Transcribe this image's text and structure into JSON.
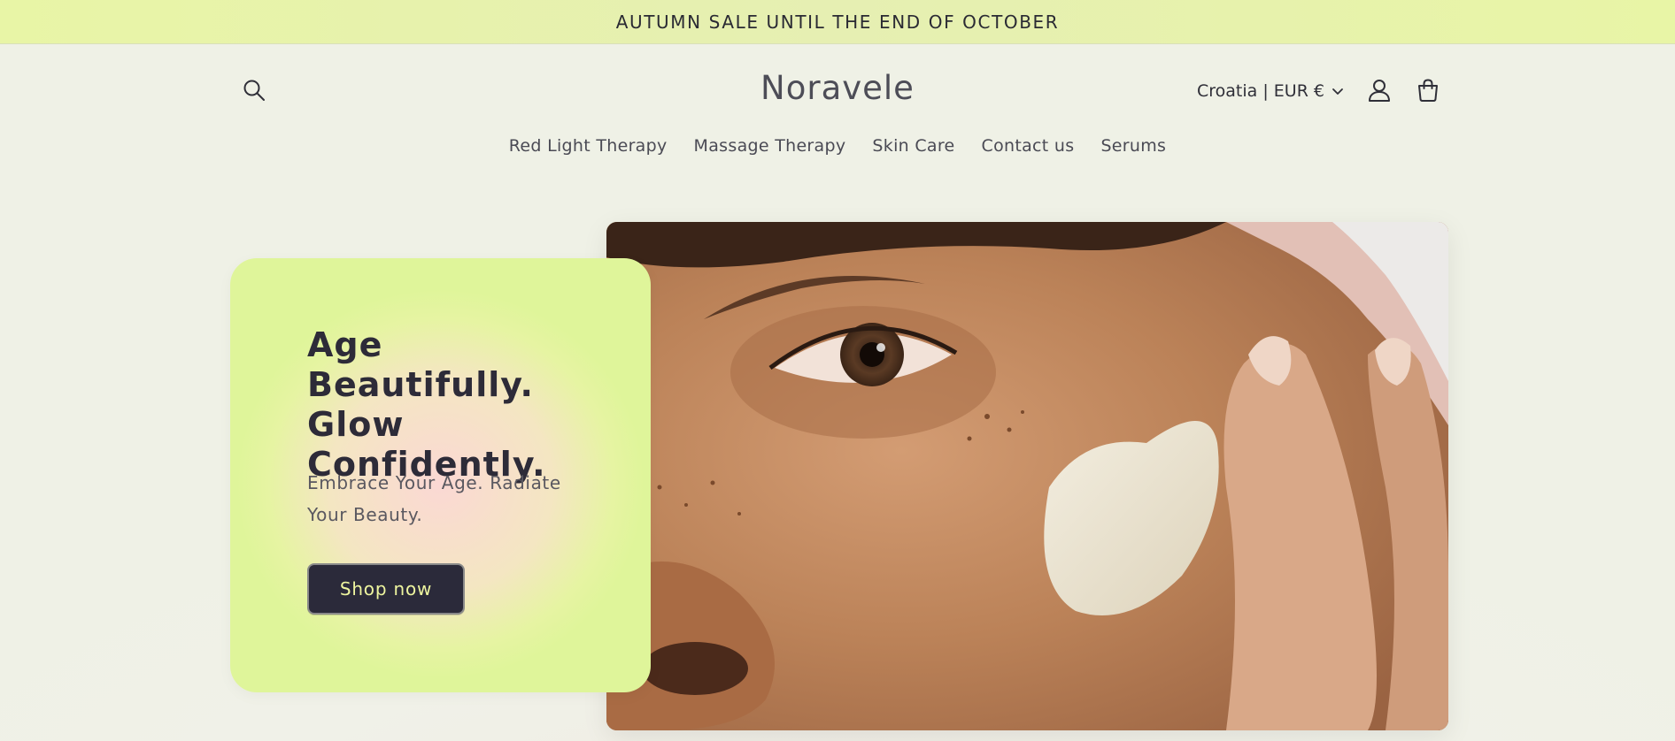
{
  "announcement": {
    "text": "AUTUMN SALE UNTIL THE END OF OCTOBER"
  },
  "header": {
    "logo": "Noravele",
    "locale": "Croatia | EUR €",
    "icons": {
      "search": "search-icon",
      "account": "user-icon",
      "cart": "cart-icon",
      "chevron": "chevron-down-icon"
    }
  },
  "nav": {
    "items": [
      {
        "label": "Red Light Therapy"
      },
      {
        "label": "Massage Therapy"
      },
      {
        "label": "Skin Care"
      },
      {
        "label": "Contact us"
      },
      {
        "label": "Serums"
      }
    ]
  },
  "hero": {
    "title": "Age Beautifully. Glow Confidently.",
    "subtitle": "Embrace Your Age. Radiate Your Beauty.",
    "button_label": "Shop now"
  },
  "colors": {
    "announcement_bg": "#e8f5a6",
    "button_bg": "#2b2a3a",
    "button_text": "#eef59f",
    "card_gradient_edge": "#dff59a",
    "card_gradient_center": "#fbd8d4"
  }
}
